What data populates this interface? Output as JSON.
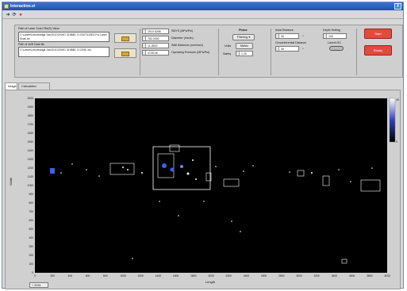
{
  "window": {
    "title": "Interaction.vi",
    "close_label": "X"
  },
  "toolbar": {
    "icons": [
      "run-arrow-icon",
      "run-continuous-icon",
      "stop-icon"
    ]
  },
  "controls": {
    "path_label": "Path of Laser Scan File(S) Value",
    "path1": "C:\\Laser\\Letchbridge Jan2011\\GSHD 319880, D:2007\\12503 Ful Laser Scan.txt",
    "path2_label": "Path of shift Data file",
    "path2": "C:\\Laser\\Letchbridge Jan2011\\GSHD 319880, D:2005 .xls",
    "params": [
      {
        "value": "2010.5298",
        "label": "SMYS (MPa/Psi)"
      },
      {
        "value": "762.0000",
        "label": "Diameter (mm/in)"
      },
      {
        "value": "11.2500",
        "label": "Wall thickness (mm/inch)"
      },
      {
        "value": "4728.06",
        "label": "Operating Pressure (MPa/Psi)"
      }
    ],
    "phase_label": "Phase",
    "phase_value": "Filtering",
    "units_label": "Units",
    "units_value": "Metric",
    "safety_label": "Safety",
    "safety_value": "1.25",
    "axial_label": "Axial Distance",
    "axial_value": "30",
    "circ_label": "Circumferential Distance",
    "circ_value": "30",
    "depth_label": "Depth Setting",
    "depth_value": "100",
    "laser_label": "Laser/LSC",
    "start_label": "Start",
    "ready_label": "Ready"
  },
  "tabs": [
    {
      "label": "Image"
    },
    {
      "label": "Calculation Results"
    }
  ],
  "plot": {
    "ylabel": "Width",
    "xlabel": "Length",
    "y_ticks": [
      "2003",
      "1900",
      "1800",
      "1700",
      "1600",
      "1500",
      "1400",
      "1300",
      "1200",
      "1100",
      "1000",
      "900",
      "800",
      "700",
      "600",
      "500",
      "400",
      "300",
      "200",
      "100",
      "0"
    ],
    "x_ticks": [
      "0",
      "200",
      "400",
      "600",
      "800",
      "1000",
      "1200",
      "1400",
      "1600",
      "1800",
      "2000",
      "2200",
      "2400",
      "2600",
      "2800",
      "3000",
      "3200",
      "3400",
      "3600",
      "3800",
      "4033"
    ],
    "colorbar_max": "40",
    "colorbar_min": "0",
    "zoom_box": "+ 2091"
  },
  "colors": {
    "plot_bg": "#000000",
    "feature": "#ffffff",
    "highlight": "#4a6cff"
  }
}
